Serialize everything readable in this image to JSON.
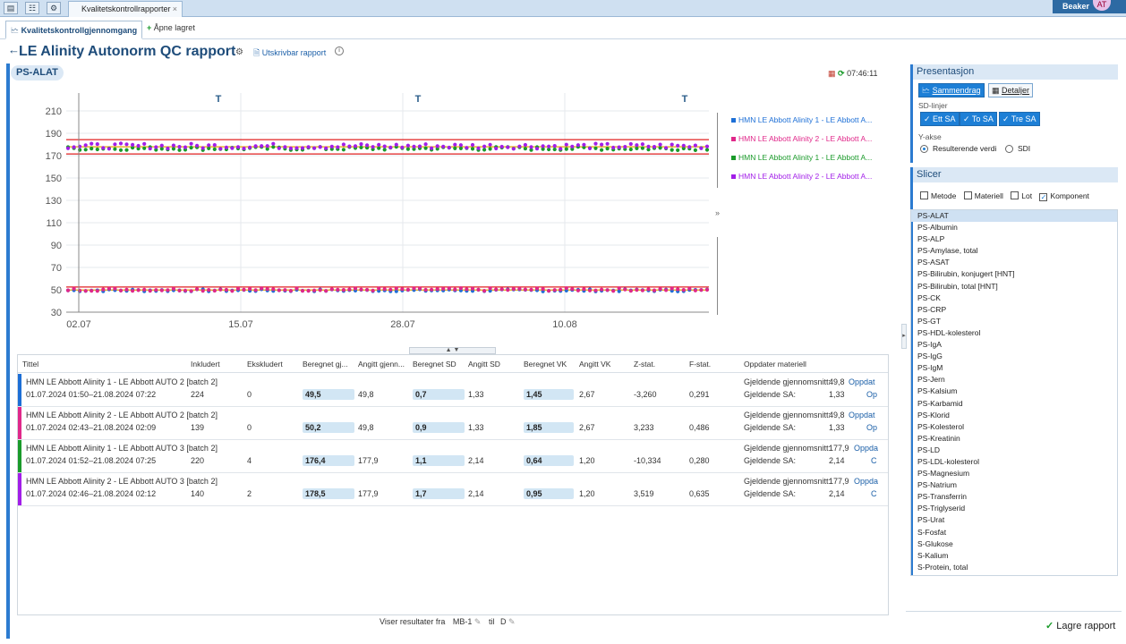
{
  "topbar": {
    "tab_title": "Kvalitetskontrollrapporter",
    "close": "×",
    "brand": "Beaker",
    "avatar": "AT"
  },
  "subtabs": {
    "active": "Kvalitetskontrollgjennomgang",
    "open_saved": "Åpne lagret"
  },
  "header": {
    "title": "LE Alinity Autonorm QC rapport",
    "print_link": "Utskrivbar rapport",
    "info": "i"
  },
  "chart_panel": {
    "tag": "PS-ALAT",
    "time": "07:46:11"
  },
  "chart_data": {
    "type": "scatter",
    "title": "PS-ALAT",
    "xlabel": "",
    "ylabel": "",
    "x_ticks": [
      "02.07",
      "15.07",
      "28.07",
      "10.08"
    ],
    "y_ticks": [
      30,
      50,
      70,
      90,
      110,
      130,
      150,
      170,
      190,
      210
    ],
    "ylim": [
      30,
      210
    ],
    "x_range": [
      "01.07.2024",
      "21.08.2024"
    ],
    "grid": true,
    "legend_position": "right",
    "series": [
      {
        "name": "HMN LE Abbott Alinity 1 - LE Abbott A...",
        "color": "#1d6fd6",
        "mean": 49.5,
        "sd": 0.7
      },
      {
        "name": "HMN LE Abbott Alinity 2 - LE Abbott A...",
        "color": "#e0288a",
        "mean": 50.2,
        "sd": 0.9
      },
      {
        "name": "HMN LE Abbott Alinity 1 - LE Abbott A...",
        "color": "#1a9a2a",
        "mean": 176.4,
        "sd": 1.1
      },
      {
        "name": "HMN LE Abbott Alinity 2 - LE Abbott A...",
        "color": "#a21ee8",
        "mean": 178.5,
        "sd": 1.7
      }
    ],
    "reference_lines": [
      {
        "level": 49.8,
        "color": "#e8a400"
      },
      {
        "level": 52.5,
        "color": "#e02020"
      },
      {
        "level": 177.9,
        "color": "#e8a400"
      },
      {
        "level": 184.3,
        "color": "#e02020"
      },
      {
        "level": 171.5,
        "color": "#e02020"
      }
    ],
    "markers": [
      "T",
      "T",
      "T"
    ]
  },
  "table": {
    "headers": [
      "Tittel",
      "Inkludert",
      "Ekskludert",
      "Beregnet gj...",
      "Angitt gjenn...",
      "Beregnet SD",
      "Angitt SD",
      "Beregnet VK",
      "Angitt VK",
      "Z-stat.",
      "F-stat.",
      "Oppdater materiell"
    ],
    "rows": [
      {
        "title": "HMN LE Abbott Alinity 1 - LE Abbott AUTO 2 [batch 2]",
        "period": "01.07.2024 01:50–21.08.2024 07:22",
        "included": "224",
        "excluded": "0",
        "calc_mean": "49,5",
        "set_mean": "49,8",
        "calc_sd": "0,7",
        "set_sd": "1,33",
        "calc_cv": "1,45",
        "set_cv": "2,67",
        "z": "-3,260",
        "f": "0,291",
        "cur_mean_label": "Gjeldende gjennomsnitt:",
        "cur_mean": "49,8",
        "cur_sd_label": "Gjeldende SA:",
        "cur_sd": "1,33",
        "upd1": "Oppdat",
        "upd2": "Op",
        "color": "#1d6fd6"
      },
      {
        "title": "HMN LE Abbott Alinity 2 - LE Abbott AUTO 2 [batch 2]",
        "period": "01.07.2024 02:43–21.08.2024 02:09",
        "included": "139",
        "excluded": "0",
        "calc_mean": "50,2",
        "set_mean": "49,8",
        "calc_sd": "0,9",
        "set_sd": "1,33",
        "calc_cv": "1,85",
        "set_cv": "2,67",
        "z": "3,233",
        "f": "0,486",
        "cur_mean_label": "Gjeldende gjennomsnitt:",
        "cur_mean": "49,8",
        "cur_sd_label": "Gjeldende SA:",
        "cur_sd": "1,33",
        "upd1": "Oppdat",
        "upd2": "Op",
        "color": "#e0288a"
      },
      {
        "title": "HMN LE Abbott Alinity 1 - LE Abbott AUTO 3 [batch 2]",
        "period": "01.07.2024 01:52–21.08.2024 07:25",
        "included": "220",
        "excluded": "4",
        "calc_mean": "176,4",
        "set_mean": "177,9",
        "calc_sd": "1,1",
        "set_sd": "2,14",
        "calc_cv": "0,64",
        "set_cv": "1,20",
        "z": "-10,334",
        "f": "0,280",
        "cur_mean_label": "Gjeldende gjennomsnitt:",
        "cur_mean": "177,9",
        "cur_sd_label": "Gjeldende SA:",
        "cur_sd": "2,14",
        "upd1": "Oppda",
        "upd2": "C",
        "color": "#1a9a2a"
      },
      {
        "title": "HMN LE Abbott Alinity 2 - LE Abbott AUTO 3 [batch 2]",
        "period": "01.07.2024 02:46–21.08.2024 02:12",
        "included": "140",
        "excluded": "2",
        "calc_mean": "178,5",
        "set_mean": "177,9",
        "calc_sd": "1,7",
        "set_sd": "2,14",
        "calc_cv": "0,95",
        "set_cv": "1,20",
        "z": "3,519",
        "f": "0,635",
        "cur_mean_label": "Gjeldende gjennomsnitt:",
        "cur_mean": "177,9",
        "cur_sd_label": "Gjeldende SA:",
        "cur_sd": "2,14",
        "upd1": "Oppda",
        "upd2": "C",
        "color": "#a21ee8"
      }
    ]
  },
  "footer": {
    "showing": "Viser resultater fra",
    "from": "MB-1",
    "to_label": "til",
    "to": "D"
  },
  "presentation": {
    "title": "Presentasjon",
    "summary": "Sammendrag",
    "details": "Detaljer",
    "sd_label": "SD-linjer",
    "sd1": "✓ Ett SA",
    "sd2": "✓ To SA",
    "sd3": "✓ Tre SA",
    "yaxis_label": "Y-akse",
    "y_opt1": "Resulterende verdi",
    "y_opt2": "SDI"
  },
  "slicer": {
    "title": "Slicer",
    "filters": [
      "Metode",
      "Materiell",
      "Lot",
      "Komponent"
    ],
    "components": [
      "PS-ALAT",
      "PS-Albumin",
      "PS-ALP",
      "PS-Amylase, total",
      "PS-ASAT",
      "PS-Bilirubin, konjugert [HNT]",
      "PS-Bilirubin, total [HNT]",
      "PS-CK",
      "PS-CRP",
      "PS-GT",
      "PS-HDL-kolesterol",
      "PS-IgA",
      "PS-IgG",
      "PS-IgM",
      "PS-Jern",
      "PS-Kalsium",
      "PS-Karbamid",
      "PS-Klorid",
      "PS-Kolesterol",
      "PS-Kreatinin",
      "PS-LD",
      "PS-LDL-kolesterol",
      "PS-Magnesium",
      "PS-Natrium",
      "PS-Transferrin",
      "PS-Triglyserid",
      "PS-Urat",
      "S-Fosfat",
      "S-Glukose",
      "S-Kalium",
      "S-Protein, total"
    ]
  },
  "save_label": "Lagre rapport"
}
